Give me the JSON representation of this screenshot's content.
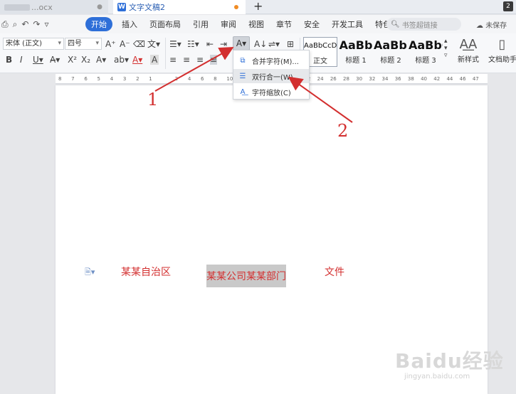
{
  "tabs": [
    {
      "label": "...ocx",
      "modified": false
    },
    {
      "label": "文字文稿2",
      "modified": true
    }
  ],
  "window_badge": "2",
  "menu": {
    "items": [
      "开始",
      "插入",
      "页面布局",
      "引用",
      "审阅",
      "视图",
      "章节",
      "安全",
      "开发工具",
      "特色功能"
    ],
    "active": "开始",
    "search_placeholder": "书签超链接",
    "save_status": "未保存"
  },
  "ribbon": {
    "font_name": "宋体 (正文)",
    "font_size": "四号",
    "styles": [
      {
        "sample": "AaBbCcDd",
        "name": "正文"
      },
      {
        "sample": "AaBb",
        "name": "标题 1"
      },
      {
        "sample": "AaBb(",
        "name": "标题 2"
      },
      {
        "sample": "AaBbC",
        "name": "标题 3"
      }
    ],
    "new_style_label": "新样式",
    "doc_helper_label": "文档助手"
  },
  "ruler_numbers": [
    "8",
    "7",
    "6",
    "5",
    "4",
    "3",
    "2",
    "1",
    "",
    "2",
    "4",
    "6",
    "8",
    "10",
    "12",
    "14",
    "16",
    "18",
    "20",
    "22",
    "24",
    "26",
    "28",
    "30",
    "32",
    "34",
    "36",
    "38",
    "40",
    "42",
    "44",
    "46",
    "47"
  ],
  "dropdown": {
    "items": [
      {
        "label": "合并字符(M)...",
        "icon": "merge-chars-icon"
      },
      {
        "label": "双行合一(W)...",
        "icon": "two-lines-in-one-icon"
      },
      {
        "label": "字符缩放(C)",
        "icon": "char-scale-icon"
      }
    ],
    "hovered_index": 1
  },
  "document": {
    "segments": [
      "某某自治区",
      "某某公司某某部门",
      "文件"
    ],
    "selected_index": 1,
    "text_color": "#d32f2f"
  },
  "annotations": {
    "labels": [
      "1",
      "2"
    ],
    "color": "#d32f2f"
  },
  "watermark": {
    "brand": "Baidu经验",
    "url": "jingyan.baidu.com"
  }
}
